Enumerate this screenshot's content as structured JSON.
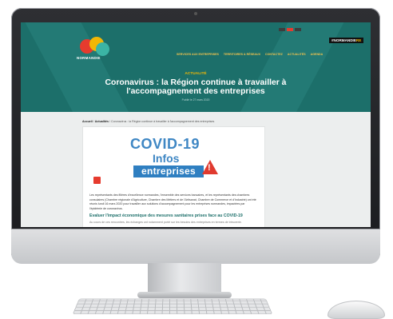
{
  "site": {
    "brand_name": "NORMANDIE",
    "brand_badge_prefix": "#NORMANDIE",
    "brand_badge_suffix": "RE",
    "nav": [
      "SERVICES AUX ENTREPRISES",
      "TERRITOIRES & RÉSEAUX",
      "CONTACTEZ",
      "ACTUALITÉS",
      "AGENDA"
    ],
    "accent_color": "#f2b705",
    "hero_color": "#1c6f6a"
  },
  "article": {
    "kicker": "ACTUALITÉ",
    "title": "Coronavirus : la Région continue à travailler à l'accompagnement des entreprises",
    "date": "Publié le 27 mars 2020",
    "breadcrumb": {
      "home": "Accueil",
      "section": "Actualités",
      "current": "Coronavirus : la Région continue à travailler à l'accompagnement des entreprises"
    },
    "poster": {
      "line1": "COVID-19",
      "line2": "Infos",
      "line3": "entreprises",
      "warning_icon": "warning-triangle-icon",
      "warning_symbol": "!"
    },
    "intro": "Les représentants des filières d'excellence normandes, l'ensemble des services bancaires, et les représentants des chambres consulaires (Chambre régionale d'Agriculture, Chambre des Métiers et de l'Artisanat, Chambre de Commerce et d'Industrie) ont été réunis lundi 16 mars 2020 pour travailler aux solutions d'accompagnement pour les entreprises normandes, impactées par l'épidémie de coronavirus.",
    "subheading": "Evaluer l'impact économique des mesures sanitaires prises face au COVID-19",
    "body_start": "Au cours de ces rencontres, les échanges ont notamment porté sur les besoins des entreprises en termes de trésorerie."
  }
}
